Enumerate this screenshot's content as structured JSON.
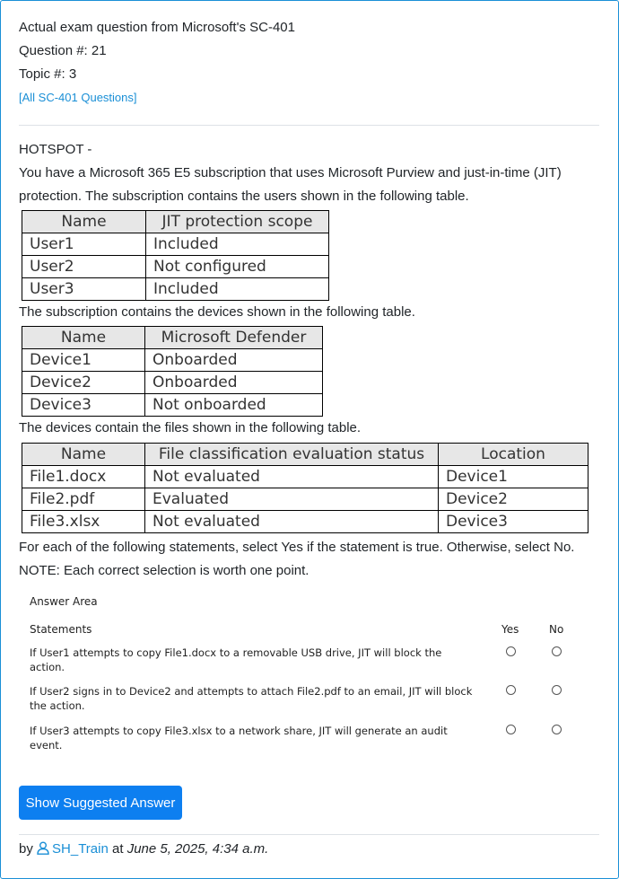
{
  "header": {
    "line1": "Actual exam question from Microsoft's SC-401",
    "line2": "Question #: 21",
    "line3": "Topic #: 3",
    "all_questions_link": "[All SC-401 Questions]"
  },
  "question": {
    "type": "HOTSPOT -",
    "intro": "You have a Microsoft 365 E5 subscription that uses Microsoft Purview and just-in-time (JIT) protection. The subscription contains the users shown in the following table.",
    "devices_intro": "The subscription contains the devices shown in the following table.",
    "files_intro": "The devices contain the files shown in the following table.",
    "instruction": "For each of the following statements, select Yes if the statement is true. Otherwise, select No.",
    "note": "NOTE: Each correct selection is worth one point."
  },
  "users_table": {
    "headers": [
      "Name",
      "JIT protection scope"
    ],
    "rows": [
      [
        "User1",
        "Included"
      ],
      [
        "User2",
        "Not configured"
      ],
      [
        "User3",
        "Included"
      ]
    ]
  },
  "devices_table": {
    "headers": [
      "Name",
      "Microsoft Defender"
    ],
    "rows": [
      [
        "Device1",
        "Onboarded"
      ],
      [
        "Device2",
        "Onboarded"
      ],
      [
        "Device3",
        "Not onboarded"
      ]
    ]
  },
  "files_table": {
    "headers": [
      "Name",
      "File classification evaluation status",
      "Location"
    ],
    "rows": [
      [
        "File1.docx",
        "Not evaluated",
        "Device1"
      ],
      [
        "File2.pdf",
        "Evaluated",
        "Device2"
      ],
      [
        "File3.xlsx",
        "Not evaluated",
        "Device3"
      ]
    ]
  },
  "answer_area": {
    "title": "Answer Area",
    "statements_header": "Statements",
    "yes_label": "Yes",
    "no_label": "No",
    "statements": [
      "If User1 attempts to copy File1.docx to a removable USB drive, JIT will block the action.",
      "If User2 signs in to Device2 and attempts to attach File2.pdf to an email, JIT will block the action.",
      "If User3 attempts to copy File3.xlsx to a network share, JIT will generate an audit event."
    ]
  },
  "actions": {
    "show_answer": "Show Suggested Answer"
  },
  "footer": {
    "by": "by",
    "username": "SH_Train",
    "at": "at",
    "date": "June 5, 2025, 4:34 a.m."
  },
  "colors": {
    "accent": "#1a8fd6",
    "button": "#0d7ff0",
    "table_header_bg": "#e7e7e7"
  },
  "icons": {
    "user": "user-icon"
  }
}
